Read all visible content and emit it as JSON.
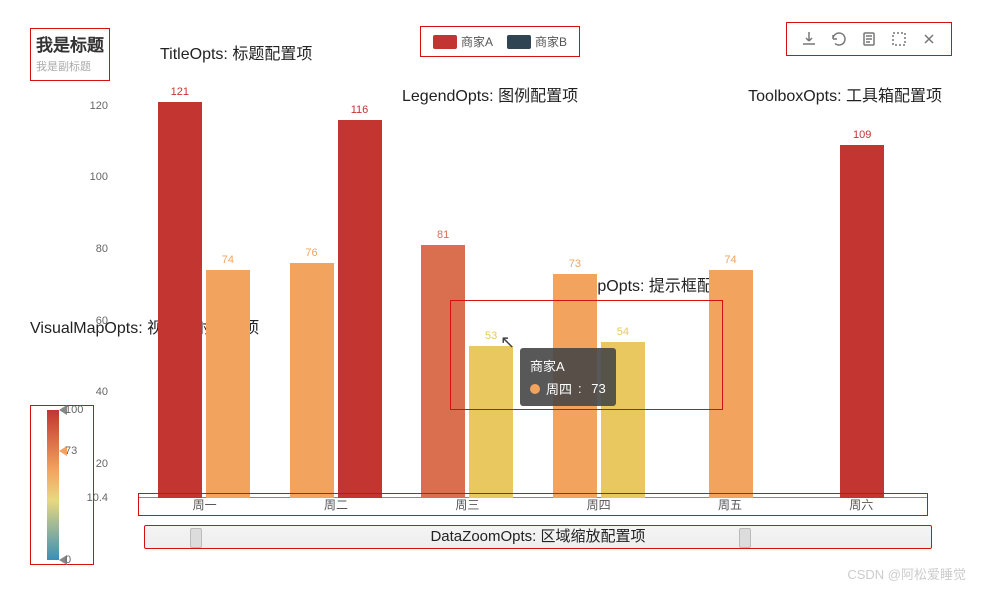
{
  "title": {
    "main": "我是标题",
    "sub": "我是副标题"
  },
  "legend": {
    "items": [
      {
        "name": "商家A",
        "color": "#c23531"
      },
      {
        "name": "商家B",
        "color": "#2f4554"
      }
    ]
  },
  "annotations": {
    "title": "TitleOpts: 标题配置项",
    "legend": "LegendOpts: 图例配置项",
    "toolbox": "ToolboxOpts: 工具箱配置项",
    "vmap": "VisualMapOpts: 视觉映射配置项",
    "tooltip": "TooltipOpts: 提示框配置项",
    "datazoom": "DataZoomOpts: 区域缩放配置项"
  },
  "toolbox": [
    "download",
    "refresh",
    "data-view",
    "zoom-area",
    "zoom-reset"
  ],
  "yaxis": {
    "ticks": [
      10.4,
      20,
      40,
      60,
      80,
      100,
      120
    ],
    "min": 10.4,
    "max": 125
  },
  "visualmap": {
    "min": 0,
    "max": 100,
    "current": 73
  },
  "tooltip": {
    "series": "商家A",
    "category": "周四",
    "value": "73",
    "dotColor": "#f2a35e"
  },
  "watermark": "CSDN @阿松爱睡觉",
  "chart_data": {
    "type": "bar",
    "categories": [
      "周一",
      "周二",
      "周三",
      "周四",
      "周五",
      "周六"
    ],
    "series": [
      {
        "name": "商家A",
        "values": [
          121,
          76,
          81,
          73,
          74,
          109
        ]
      },
      {
        "name": "商家B",
        "values": [
          74,
          116,
          53,
          54,
          null,
          null
        ]
      }
    ],
    "title": "我是标题",
    "subtitle": "我是副标题",
    "xlabel": "",
    "ylabel": "",
    "ylim": [
      10.4,
      125
    ],
    "visualmap_range": [
      0,
      100
    ],
    "legend_position": "top",
    "grid": false
  }
}
